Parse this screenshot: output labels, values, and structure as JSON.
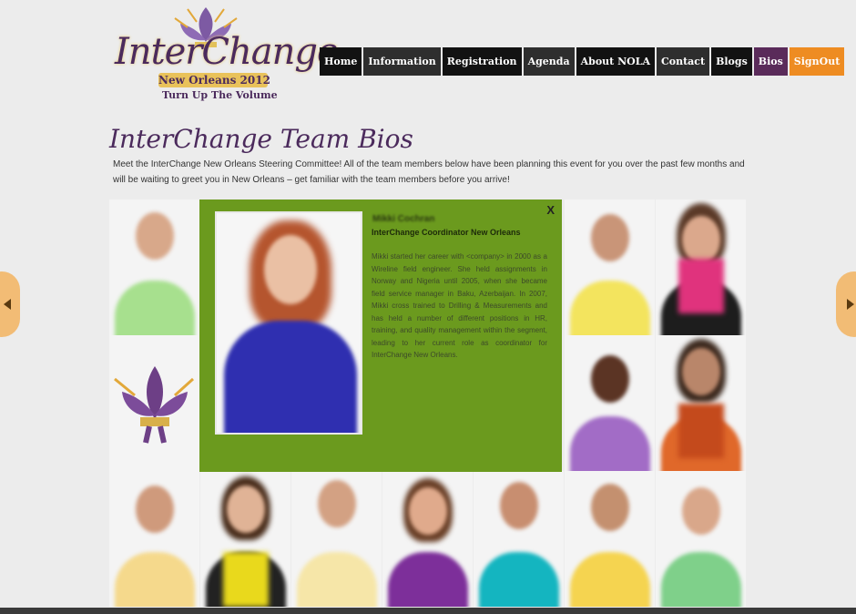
{
  "logo": {
    "main": "InterChange",
    "sub": "New Orleans 2012",
    "tagline": "Turn Up The Volume"
  },
  "nav": {
    "items": [
      {
        "label": "Home"
      },
      {
        "label": "Information"
      },
      {
        "label": "Registration"
      },
      {
        "label": "Agenda"
      },
      {
        "label": "About NOLA"
      },
      {
        "label": "Contact"
      },
      {
        "label": "Blogs"
      },
      {
        "label": "Bios"
      },
      {
        "label": "SignOut"
      }
    ]
  },
  "page": {
    "title": "InterChange Team Bios",
    "intro": "Meet the InterChange New Orleans Steering Committee! All of the team members below have been planning this event for you over the past few months and will be waiting to greet you in New Orleans – get familiar with the team members before you arrive!"
  },
  "bio": {
    "close": "X",
    "name": "Mikki Cochran",
    "role": "InterChange Coordinator New Orleans",
    "text": "Mikki started her career with <company> in 2000 as a Wireline field engineer. She held assignments in Norway and Nigeria until 2005, when she became field service manager in Baku, Azerbaijan. In 2007, Mikki cross trained to Drilling & Measurements and has held a number of different positions in HR, training, and quality management within the segment, leading to her current role as coordinator for InterChange New Orleans."
  },
  "colors": {
    "brand_purple": "#4b2a5c",
    "overlay_green": "#6b9a1e",
    "nav_black": "#121212",
    "signout_orange": "#ee8c22",
    "bios_purple": "#5a2b5a"
  }
}
